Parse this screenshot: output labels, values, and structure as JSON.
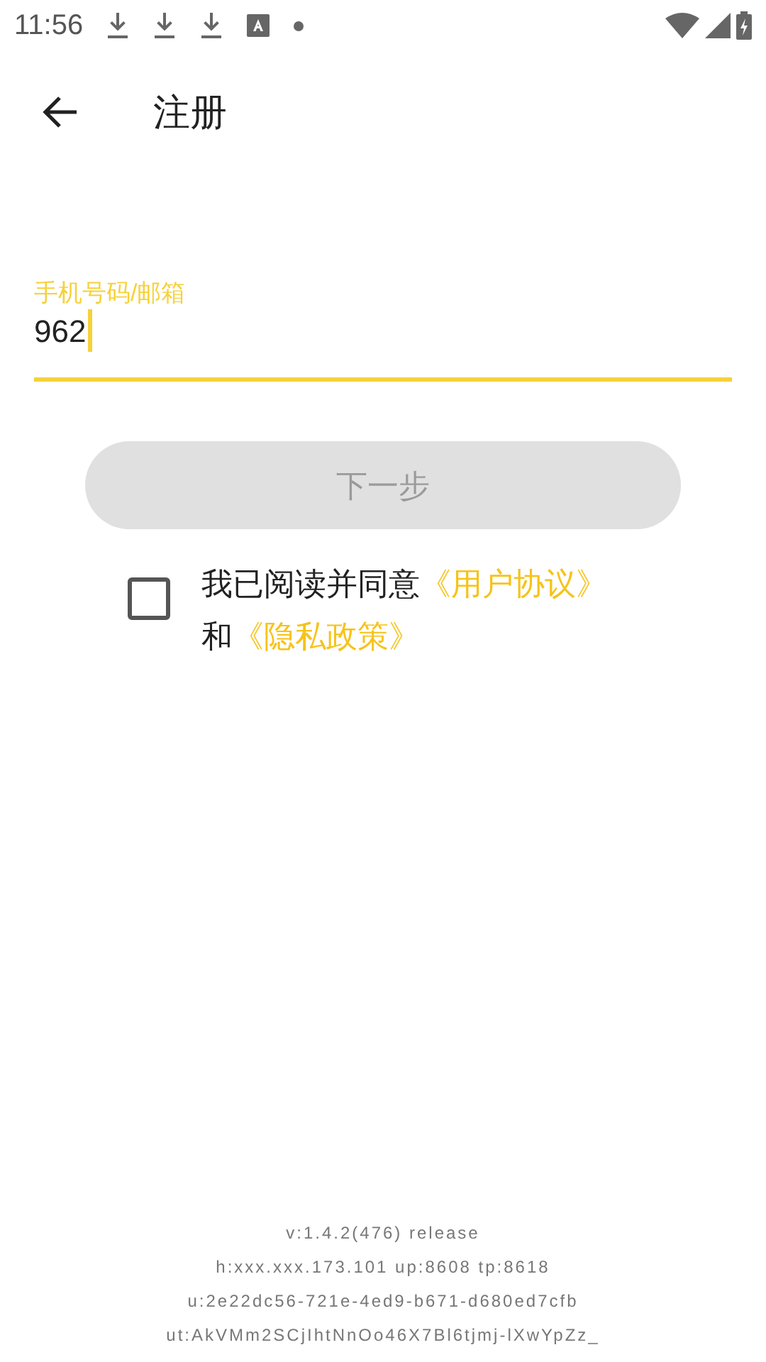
{
  "status_bar": {
    "time": "11:56",
    "notifications": [
      {
        "kind": "download"
      },
      {
        "kind": "download"
      },
      {
        "kind": "download"
      },
      {
        "kind": "text"
      },
      {
        "kind": "dot"
      }
    ]
  },
  "header": {
    "title": "注册"
  },
  "phone_field": {
    "label": "手机号码/邮箱",
    "value": "962",
    "focused": true
  },
  "next_button": {
    "label": "下一步",
    "disabled": true
  },
  "agreement": {
    "checked": false,
    "text": "我已阅读并同意",
    "link_1": "《用户协议》",
    "joiner": "和",
    "link_2": "《隐私政策》"
  },
  "footer": [
    "v:1.4.2(476) release",
    "h:xxx.xxx.173.101 up:8608 tp:8618",
    "u:2e22dc56-721e-4ed9-b671-d680ed7cfb",
    "ut:AkVMm2SCjIhtNnOo46X7Bl6tjmj-lXwYpZz_"
  ]
}
